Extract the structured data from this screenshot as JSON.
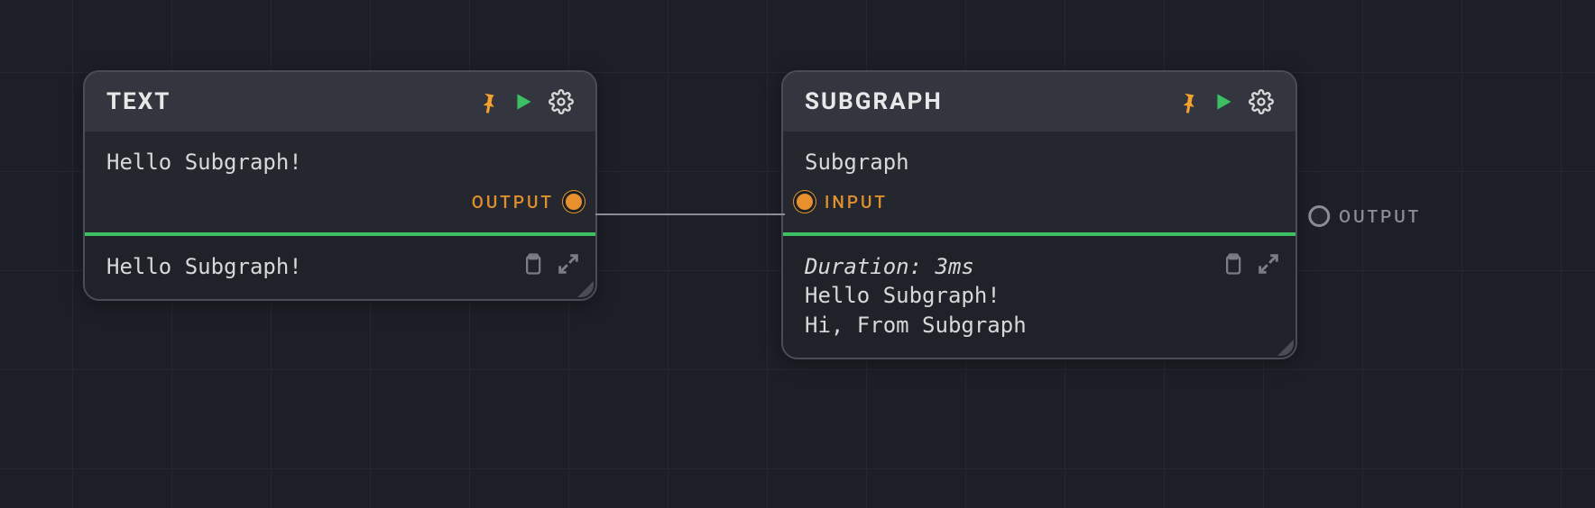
{
  "nodes": {
    "text": {
      "title": "TEXT",
      "body": "Hello Subgraph!",
      "ports": {
        "output": "OUTPUT"
      },
      "result": {
        "lines": [
          "Hello Subgraph!"
        ]
      }
    },
    "subgraph": {
      "title": "SUBGRAPH",
      "body": "Subgraph",
      "ports": {
        "input": "INPUT",
        "output": "OUTPUT"
      },
      "result": {
        "meta": "Duration: 3ms",
        "lines": [
          "Hello Subgraph!",
          "Hi, From Subgraph"
        ]
      }
    }
  },
  "icons": {
    "pin": "pin-icon",
    "run": "run-icon",
    "settings": "gear-icon",
    "copy": "clipboard-icon",
    "expand": "expand-icon"
  },
  "colors": {
    "accent_green": "#3dbf63",
    "accent_orange": "#e7912e",
    "pin_orange": "#f5a12b",
    "bg": "#1c1f26",
    "node_bg": "#24272e",
    "header_bg": "#33363e",
    "border": "#4a4d55"
  }
}
